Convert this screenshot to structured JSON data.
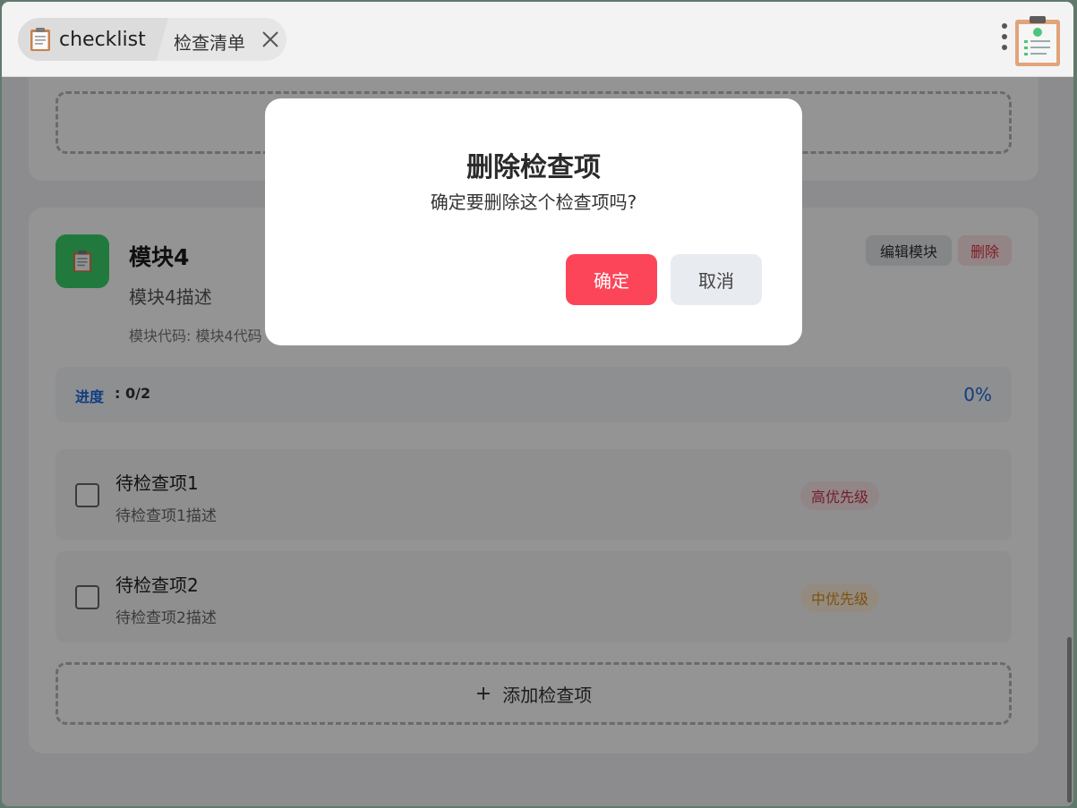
{
  "app": {
    "name": "checklist",
    "tab_label": "检查清单"
  },
  "module": {
    "title": "模块4",
    "description": "模块4描述",
    "code_text": "模块代码: 模块4代码",
    "edit_label": "编辑模块",
    "delete_label": "删除",
    "progress_label": "进度",
    "progress_count": ": 0/2",
    "progress_percent": "0%",
    "progress_fraction": 0
  },
  "items": [
    {
      "title": "待检查项1",
      "description": "待检查项1描述",
      "priority": "高优先级",
      "checked": false
    },
    {
      "title": "待检查项2",
      "description": "待检查项2描述",
      "priority": "中优先级",
      "checked": false
    }
  ],
  "add_item_label": "添加检查项",
  "dialog": {
    "title": "删除检查项",
    "message": "确定要删除这个检查项吗?",
    "confirm_label": "确定",
    "cancel_label": "取消"
  },
  "colors": {
    "confirm": "#fd4559",
    "accent": "#1a6be0",
    "module_icon_bg": "#3bd069",
    "priority_high": "#c33445",
    "priority_mid": "#d98a17"
  },
  "icons": {
    "app_logo": "clipboard-icon",
    "tab_close": "close-icon",
    "menu": "kebab-menu-icon",
    "corner": "clipboard-checklist-icon",
    "module": "clipboard-icon",
    "add": "plus-icon"
  }
}
